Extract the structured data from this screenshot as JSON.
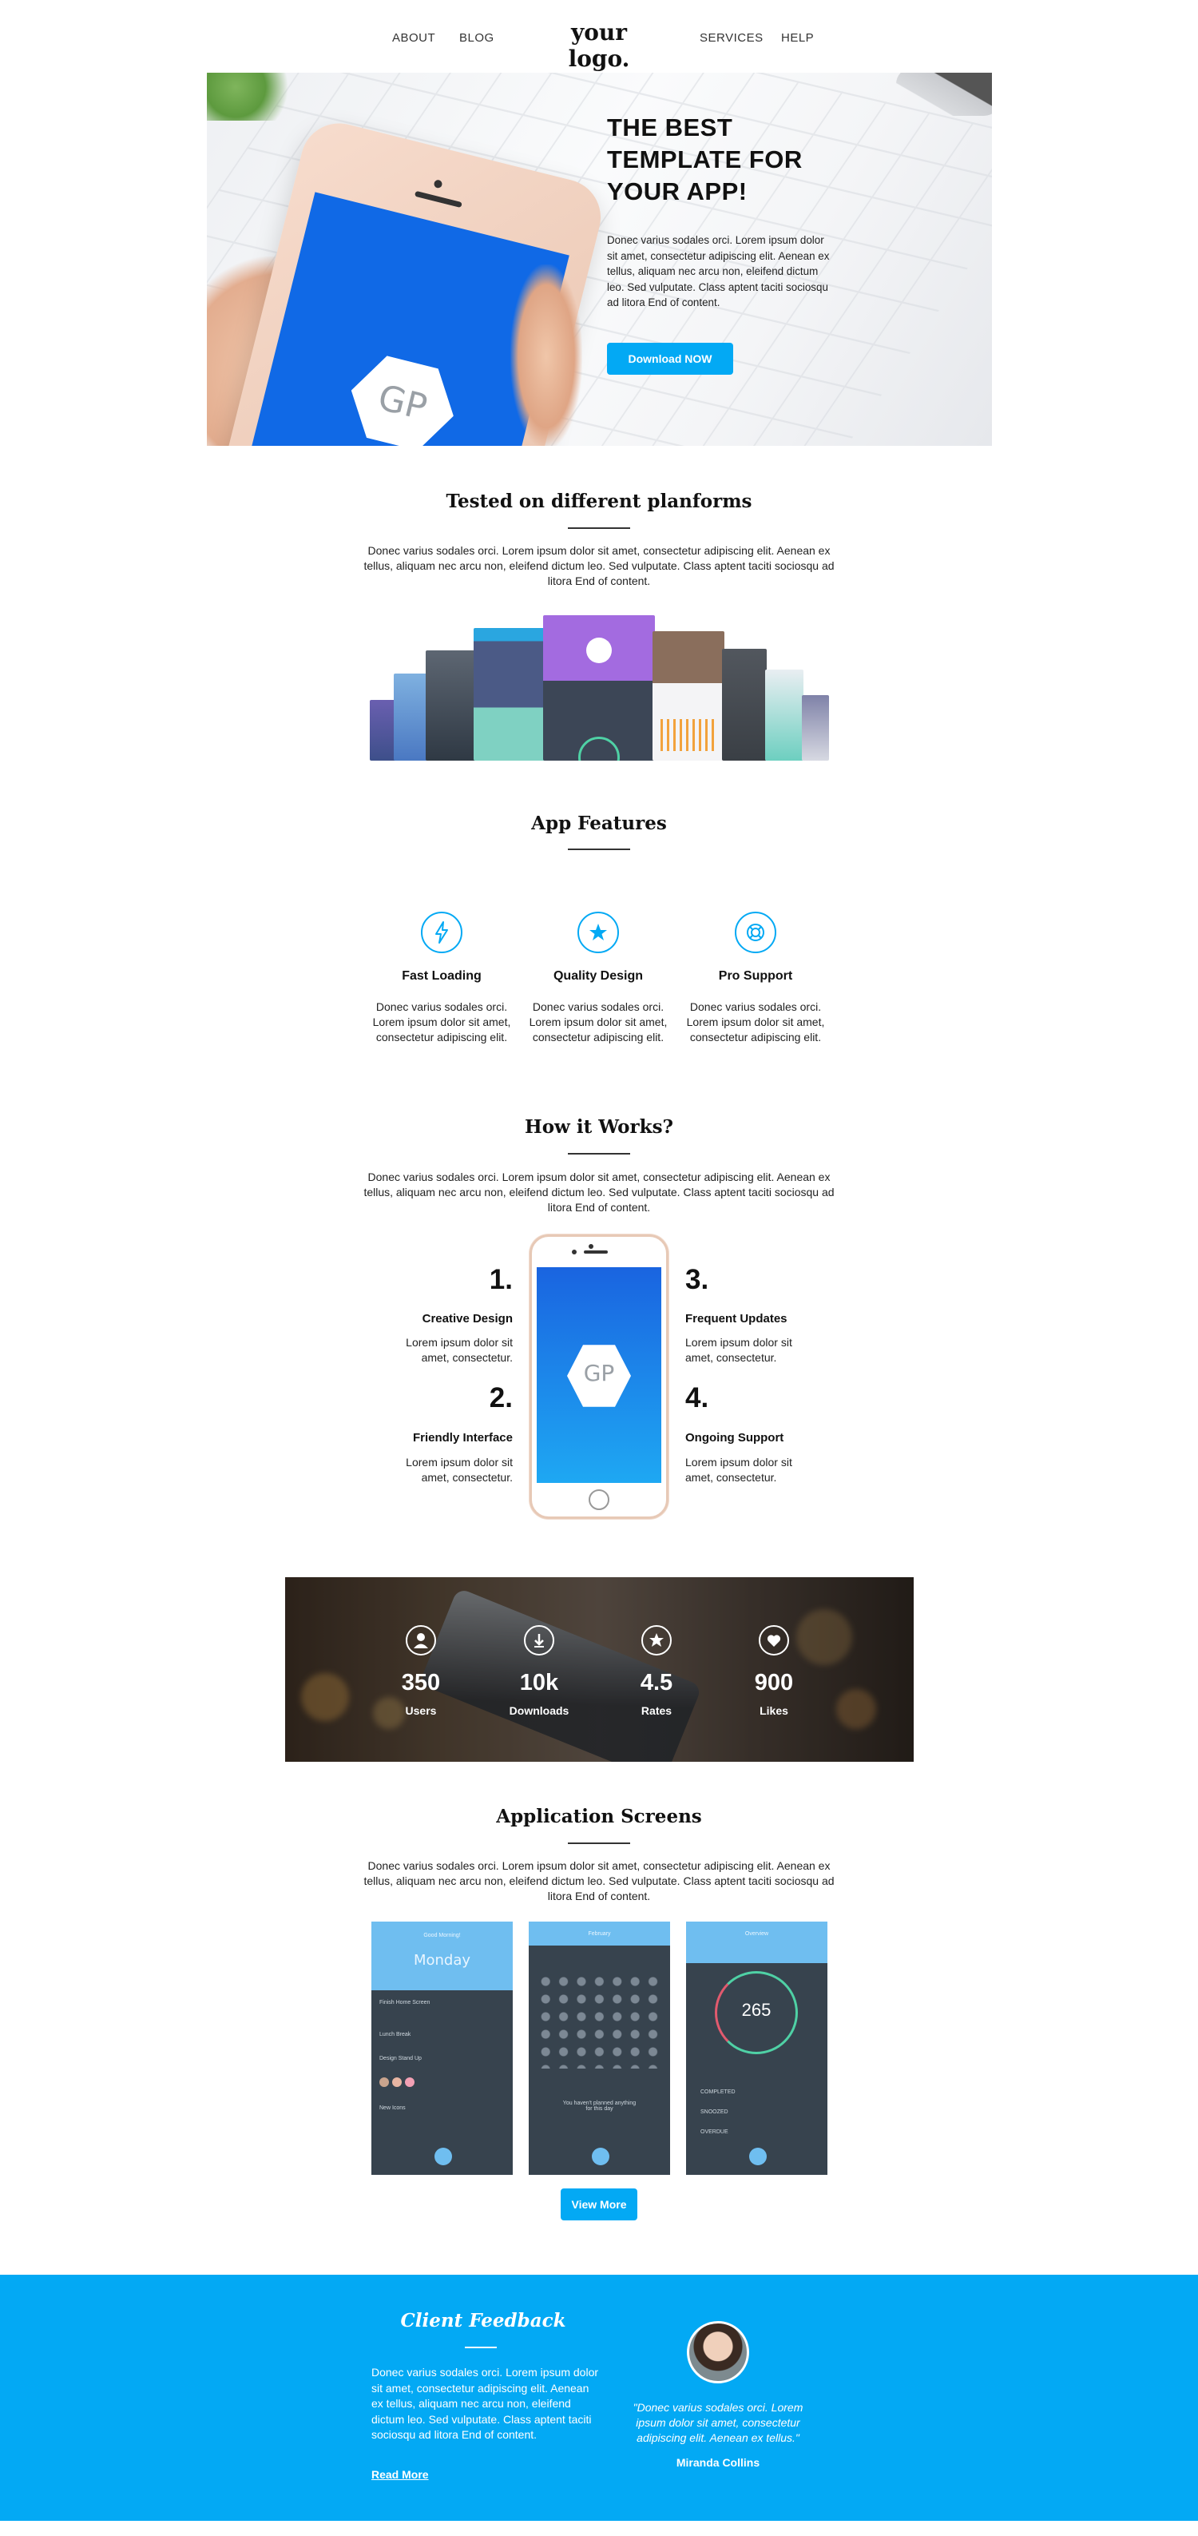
{
  "nav": {
    "about": "ABOUT",
    "blog": "BLOG",
    "logo": "your logo.",
    "services": "SERVICES",
    "help": "HELP"
  },
  "hero": {
    "title_l1": "THE BEST",
    "title_l2": "TEMPLATE FOR",
    "title_l3": "YOUR APP!",
    "text": "Donec varius sodales orci. Lorem ipsum dolor sit amet, consectetur adipiscing elit. Aenean ex tellus, aliquam nec arcu non, eleifend dictum leo. Sed vulputate. Class aptent taciti sociosqu ad litora End of content.",
    "button": "Download NOW",
    "phone_logo": "GP"
  },
  "platforms": {
    "title": "Tested on different planforms",
    "text": "Donec varius sodales orci. Lorem ipsum dolor sit amet, consectetur adipiscing elit. Aenean ex tellus, aliquam nec arcu non, eleifend dictum leo. Sed vulputate. Class aptent taciti sociosqu ad litora End of content."
  },
  "features": {
    "title": "App Features",
    "items": [
      {
        "icon": "lightning-icon",
        "title": "Fast Loading",
        "text": "Donec varius sodales orci. Lorem ipsum dolor sit amet, consectetur adipiscing elit."
      },
      {
        "icon": "star-icon",
        "title": "Quality Design",
        "text": "Donec varius sodales orci. Lorem ipsum dolor sit amet, consectetur adipiscing elit."
      },
      {
        "icon": "lifebuoy-icon",
        "title": "Pro Support",
        "text": "Donec varius sodales orci. Lorem ipsum dolor sit amet, consectetur adipiscing elit."
      }
    ]
  },
  "how": {
    "title": "How it Works?",
    "text": "Donec varius sodales orci. Lorem ipsum dolor sit amet, consectetur adipiscing elit. Aenean ex tellus, aliquam nec arcu non, eleifend dictum leo. Sed vulputate. Class aptent taciti sociosqu ad litora End of content.",
    "steps": [
      {
        "num": "1.",
        "title": "Creative Design",
        "text": "Lorem ipsum dolor sit amet, consectetur."
      },
      {
        "num": "2.",
        "title": "Friendly Interface",
        "text": "Lorem ipsum dolor sit amet, consectetur."
      },
      {
        "num": "3.",
        "title": "Frequent Updates",
        "text": "Lorem ipsum dolor sit amet, consectetur."
      },
      {
        "num": "4.",
        "title": "Ongoing Support",
        "text": "Lorem ipsum dolor sit amet, consectetur."
      }
    ],
    "phone_logo": "GP"
  },
  "stats": [
    {
      "icon": "user-icon",
      "value": "350",
      "label": "Users"
    },
    {
      "icon": "download-icon",
      "value": "10k",
      "label": "Downloads"
    },
    {
      "icon": "star-icon",
      "value": "4.5",
      "label": "Rates"
    },
    {
      "icon": "heart-icon",
      "value": "900",
      "label": "Likes"
    }
  ],
  "screens": {
    "title": "Application Screens",
    "text": "Donec varius sodales orci. Lorem ipsum dolor sit amet, consectetur adipiscing elit. Aenean ex tellus, aliquam nec arcu non, eleifend dictum leo. Sed vulputate. Class aptent taciti sociosqu ad litora End of content.",
    "s1": {
      "header": "Good Morning!",
      "day": "Monday",
      "rows": [
        "Finish Home Screen",
        "Lunch Break",
        "Design Stand Up",
        "New Icons"
      ]
    },
    "s2": {
      "header": "February",
      "empty": "You haven't planned anything for this day"
    },
    "s3": {
      "header": "Overview",
      "big": "265",
      "rows": [
        "COMPLETED",
        "SNOOZED",
        "OVERDUE"
      ]
    },
    "button": "View More"
  },
  "feedback": {
    "title": "Client Feedback",
    "text": "Donec varius sodales orci. Lorem ipsum dolor sit amet, consectetur adipiscing elit. Aenean ex tellus, aliquam nec arcu non, eleifend dictum leo. Sed vulputate. Class aptent taciti sociosqu ad litora End of content.",
    "link": "Read More",
    "quote": "\"Donec varius sodales orci. Lorem ipsum dolor sit amet, consectetur adipiscing elit. Aenean ex tellus.\"",
    "name": "Miranda Collins"
  },
  "colors": {
    "accent": "#03a9f4",
    "screen_blue": "#1069e6",
    "app_dark": "#37434e",
    "app_light": "#6fbef0"
  }
}
